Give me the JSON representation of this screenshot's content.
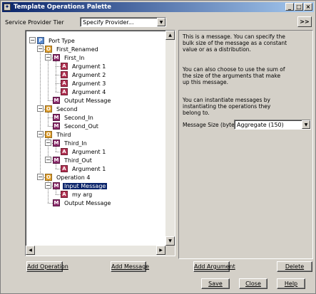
{
  "window": {
    "title": "Template Operations Palette",
    "controls": [
      "_",
      "□",
      "×"
    ]
  },
  "toolbar": {
    "provider_label": "Service Provider Tier",
    "provider_value": "Specify Provider...",
    "expand_label": ">>"
  },
  "tree": {
    "nodes": [
      {
        "label": "Port Type",
        "icon": "P",
        "type": "port-type"
      },
      {
        "label": "First_Renamed",
        "icon": "O",
        "type": "operation"
      },
      {
        "label": "First_In",
        "icon": "M",
        "type": "message"
      },
      {
        "label": "Argument 1",
        "icon": "A",
        "type": "argument"
      },
      {
        "label": "Argument 2",
        "icon": "A",
        "type": "argument"
      },
      {
        "label": "Argument 3",
        "icon": "A",
        "type": "argument"
      },
      {
        "label": "Argument 4",
        "icon": "A",
        "type": "argument"
      },
      {
        "label": "Output Message",
        "icon": "M",
        "type": "message"
      },
      {
        "label": "Second",
        "icon": "O",
        "type": "operation"
      },
      {
        "label": "Second_In",
        "icon": "M",
        "type": "message"
      },
      {
        "label": "Second_Out",
        "icon": "M",
        "type": "message"
      },
      {
        "label": "Third",
        "icon": "O",
        "type": "operation"
      },
      {
        "label": "Third_In",
        "icon": "M",
        "type": "message"
      },
      {
        "label": "Argument 1",
        "icon": "A",
        "type": "argument"
      },
      {
        "label": "Third_Out",
        "icon": "M",
        "type": "message"
      },
      {
        "label": "Argument 1",
        "icon": "A",
        "type": "argument"
      },
      {
        "label": "Operation 4",
        "icon": "O",
        "type": "operation"
      },
      {
        "label": "Input Message",
        "icon": "M",
        "type": "message",
        "selected": true
      },
      {
        "label": "my arg",
        "icon": "A",
        "type": "argument"
      },
      {
        "label": "Output Message",
        "icon": "M",
        "type": "message"
      }
    ]
  },
  "info": {
    "para1": "This is a message. You can specify the bulk size of the message as a constant value or as a distribution.",
    "para2": "You can also choose to use the sum of the size of the arguments that make up this message.",
    "para3": "You can instantiate messages by instantiating the operations they belong to.",
    "size_label": "Message Size (bytes):",
    "size_value": "Aggregate (150)"
  },
  "buttons": {
    "add_operation": "Add Operation",
    "add_message": "Add Message",
    "add_argument": "Add Argument",
    "delete": "Delete",
    "save": "Save",
    "close": "Close",
    "help": "Help"
  },
  "colors": {
    "title_bar": "#0a246a",
    "selection": "#0a246a",
    "port_type_icon": "#5b8bd0",
    "operation_icon": "#e0a030",
    "message_icon": "#8a2a6a",
    "argument_icon": "#b03050"
  }
}
